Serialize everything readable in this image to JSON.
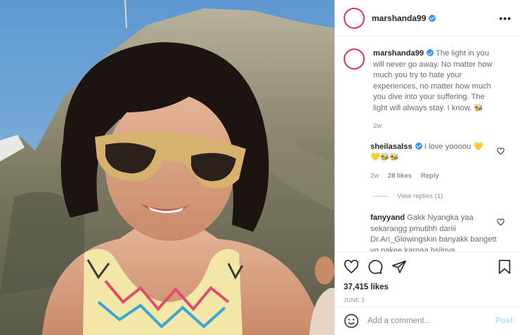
{
  "post": {
    "username": "marshanda99",
    "caption_user": "marshanda99",
    "caption_text": "The light in you will never go away. No matter how much you try to hate your experiences, no matter how much you dive into your suffering. The light will always stay. I know.",
    "caption_emoji": "🐝",
    "caption_age": "2w",
    "likes": "37,415 likes",
    "date": "JUNE 3"
  },
  "comments": [
    {
      "user": "sheilasalss",
      "text": "I love yoooou",
      "emoji_line1": "💛",
      "emoji_line2": "💛🐝🐝",
      "age": "2w",
      "likes": "28 likes",
      "reply": "Reply",
      "view_replies": "View replies (1)"
    },
    {
      "user": "fanyyand",
      "text": "Gakk Nyangka yaa sekarangg pmutihh dariii Dr.Ari_Glowingskin banyakk bangett yg pakee karnaa hsilnya"
    }
  ],
  "add_comment": {
    "placeholder": "Add a comment...",
    "post_label": "Post"
  },
  "icons": {
    "more": "more-options-icon",
    "like": "heart-icon",
    "comment": "comment-icon",
    "share": "share-icon",
    "save": "bookmark-icon",
    "emoji": "emoji-icon"
  }
}
